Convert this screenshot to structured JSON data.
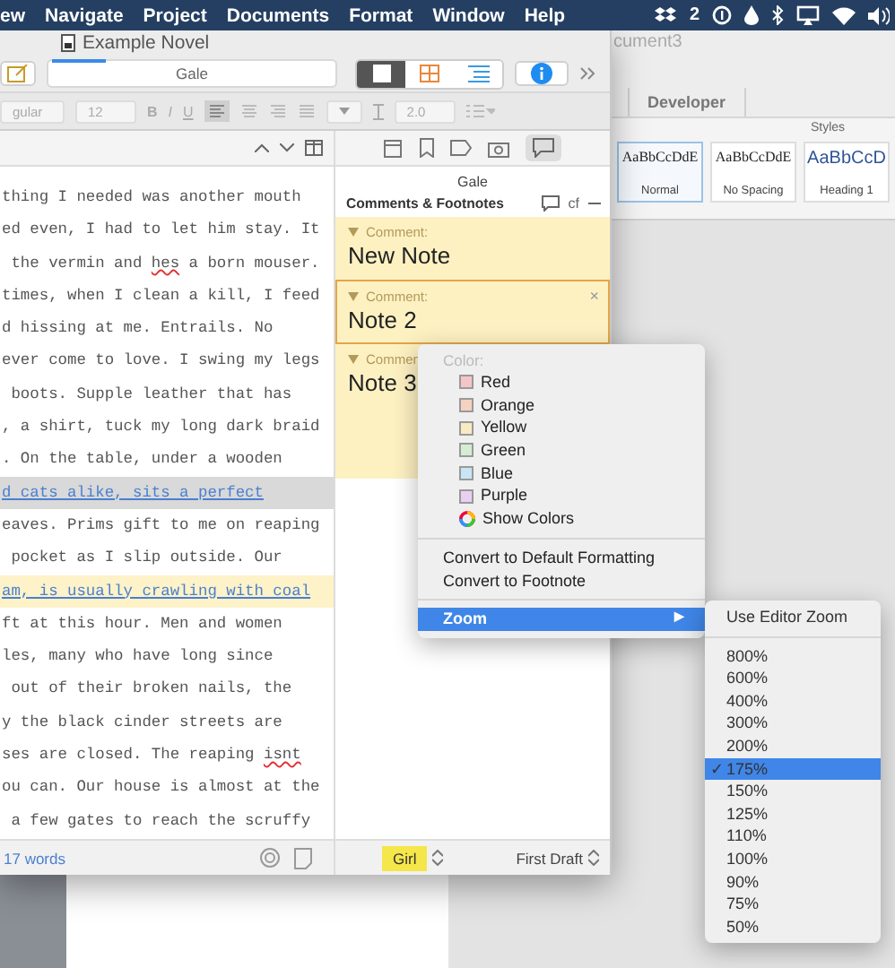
{
  "menu_bar": {
    "items": [
      "ew",
      "Navigate",
      "Project",
      "Documents",
      "Format",
      "Window",
      "Help"
    ],
    "status_count": "2"
  },
  "word_window": {
    "title": "cument3",
    "tab": "Developer",
    "styles_label": "Styles",
    "styles": [
      {
        "sample": "AaBbCcDdE",
        "name": "Normal",
        "selected": true,
        "kind": "body"
      },
      {
        "sample": "AaBbCcDdE",
        "name": "No Spacing",
        "selected": false,
        "kind": "body"
      },
      {
        "sample": "AaBbCcD",
        "name": "Heading 1",
        "selected": false,
        "kind": "heading"
      }
    ]
  },
  "window": {
    "title": "Example Novel"
  },
  "toolbar": {
    "document": "Gale"
  },
  "format_bar": {
    "font": "gular",
    "size": "12",
    "bold": "B",
    "italic": "I",
    "underline": "U",
    "spacing": "2.0"
  },
  "editor": {
    "lines": [
      {
        "kind": "plain",
        "parts": [
          {
            "text": "thing I needed was another mouth",
            "misspelled": false
          }
        ]
      },
      {
        "kind": "plain",
        "parts": [
          {
            "text": "ed even, I had to let him stay. It",
            "misspelled": false
          }
        ]
      },
      {
        "kind": "plain",
        "parts": [
          {
            "text": " the vermin and ",
            "misspelled": false
          },
          {
            "text": "hes",
            "misspelled": true
          },
          {
            "text": " a born mouser.",
            "misspelled": false
          }
        ]
      },
      {
        "kind": "plain",
        "parts": [
          {
            "text": "times, when I clean a kill, I feed",
            "misspelled": false
          }
        ]
      },
      {
        "kind": "plain",
        "parts": [
          {
            "text": "d hissing at me. Entrails. No",
            "misspelled": false
          }
        ]
      },
      {
        "kind": "plain",
        "parts": [
          {
            "text": "ever come to love. I swing my legs",
            "misspelled": false
          }
        ]
      },
      {
        "kind": "plain",
        "parts": [
          {
            "text": " boots. Supple leather that has",
            "misspelled": false
          }
        ]
      },
      {
        "kind": "plain",
        "parts": [
          {
            "text": ", a shirt, tuck my long dark braid",
            "misspelled": false
          }
        ]
      },
      {
        "kind": "plain",
        "parts": [
          {
            "text": ". On the table, under a wooden",
            "misspelled": false
          }
        ]
      },
      {
        "kind": "selection",
        "parts": [
          {
            "text": "d cats alike, sits a perfect",
            "misspelled": false
          }
        ]
      },
      {
        "kind": "plain",
        "parts": [
          {
            "text": "eaves. Prims gift to me on reaping",
            "misspelled": false
          }
        ]
      },
      {
        "kind": "plain",
        "parts": [
          {
            "text": " pocket as I slip outside. Our",
            "misspelled": false
          }
        ]
      },
      {
        "kind": "comment",
        "parts": [
          {
            "text": "am, is usually crawling with coal",
            "misspelled": false
          }
        ]
      },
      {
        "kind": "plain",
        "parts": [
          {
            "text": "ft at this hour. Men and women",
            "misspelled": false
          }
        ]
      },
      {
        "kind": "plain",
        "parts": [
          {
            "text": "les, many who have long since",
            "misspelled": false
          }
        ]
      },
      {
        "kind": "plain",
        "parts": [
          {
            "text": " out of their broken nails, the",
            "misspelled": false
          }
        ]
      },
      {
        "kind": "plain",
        "parts": [
          {
            "text": "y the black cinder streets are",
            "misspelled": false
          }
        ]
      },
      {
        "kind": "plain",
        "parts": [
          {
            "text": "ses are closed. The reaping ",
            "misspelled": false
          },
          {
            "text": "isnt",
            "misspelled": true
          }
        ]
      },
      {
        "kind": "plain",
        "parts": [
          {
            "text": "ou can. Our house is almost at the",
            "misspelled": false
          }
        ]
      },
      {
        "kind": "plain",
        "parts": [
          {
            "text": " a few gates to reach the scruffy",
            "misspelled": false
          }
        ]
      }
    ],
    "word_count": "17 words"
  },
  "inspector": {
    "title": "Gale",
    "section": "Comments & Footnotes",
    "footnote_button": "cf",
    "comments": [
      {
        "label": "Comment:",
        "text": "New Note",
        "selected": false
      },
      {
        "label": "Comment:",
        "text": "Note 2",
        "selected": true,
        "close": "×"
      },
      {
        "label": "Commen",
        "text": "Note 3",
        "selected": false
      }
    ],
    "label": {
      "text": "Girl",
      "color": "#f5e64a"
    },
    "status": "First Draft"
  },
  "context_menu": {
    "header": "Color:",
    "colors": [
      {
        "name": "Red",
        "color": "#f4c6c8"
      },
      {
        "name": "Orange",
        "color": "#f6d2c2"
      },
      {
        "name": "Yellow",
        "color": "#f8ebc2"
      },
      {
        "name": "Green",
        "color": "#d5edd3"
      },
      {
        "name": "Blue",
        "color": "#c8e5f5"
      },
      {
        "name": "Purple",
        "color": "#e9d0f2"
      }
    ],
    "show_colors": "Show Colors",
    "actions": [
      "Convert to Default Formatting",
      "Convert to Footnote"
    ],
    "submenu_item": {
      "text": "Zoom",
      "arrow": "▶",
      "selected": true
    }
  },
  "zoom_menu": {
    "editor_zoom": "Use Editor Zoom",
    "check": "✓",
    "levels": [
      {
        "text": "800%",
        "selected": false
      },
      {
        "text": "600%",
        "selected": false
      },
      {
        "text": "400%",
        "selected": false
      },
      {
        "text": "300%",
        "selected": false
      },
      {
        "text": "200%",
        "selected": false
      },
      {
        "text": "175%",
        "selected": true
      },
      {
        "text": "150%",
        "selected": false
      },
      {
        "text": "125%",
        "selected": false
      },
      {
        "text": "110%",
        "selected": false
      },
      {
        "text": "100%",
        "selected": false
      },
      {
        "text": "90%",
        "selected": false
      },
      {
        "text": "75%",
        "selected": false
      },
      {
        "text": "50%",
        "selected": false
      }
    ]
  }
}
